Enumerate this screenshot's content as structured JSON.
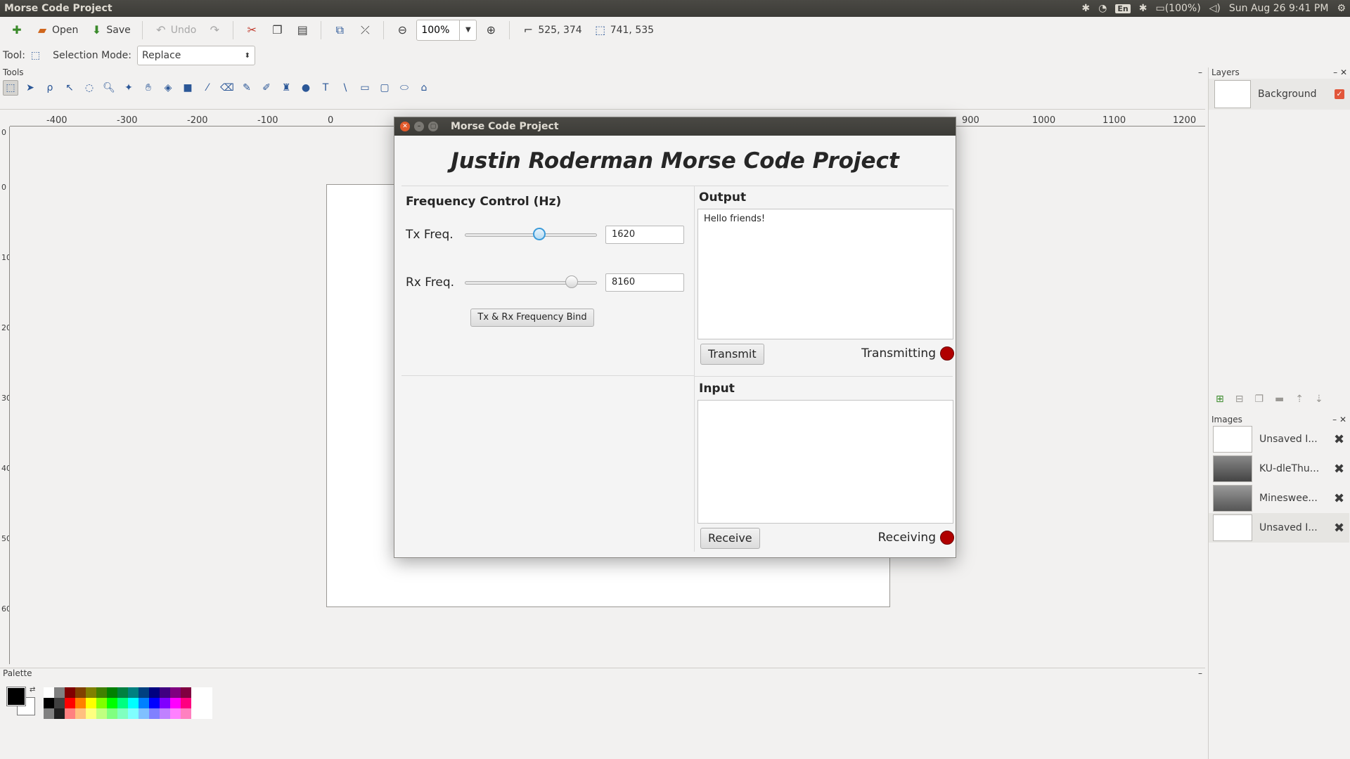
{
  "topbar": {
    "app_title": "Morse Code Project",
    "lang": "En",
    "battery": "(100%)",
    "datetime": "Sun Aug 26  9:41 PM"
  },
  "toolbar": {
    "open": "Open",
    "save": "Save",
    "undo": "Undo",
    "zoom": "100%",
    "cursor_pos": "525, 374",
    "selection_size": "741, 535"
  },
  "tool_options": {
    "tool_label": "Tool:",
    "selection_mode_label": "Selection Mode:",
    "selection_mode": "Replace"
  },
  "panels": {
    "tools": "Tools",
    "layers": "Layers",
    "images": "Images",
    "palette": "Palette"
  },
  "ruler": {
    "h_ticks": [
      "-400",
      "-300",
      "-200",
      "-100",
      "0",
      "900",
      "1000",
      "1100",
      "1200"
    ],
    "v_ticks": [
      "0",
      "0",
      "100",
      "200",
      "300",
      "400",
      "500",
      "600"
    ]
  },
  "layers": [
    {
      "name": "Background"
    }
  ],
  "images": [
    {
      "name": "Unsaved I..."
    },
    {
      "name": "KU-dleThu..."
    },
    {
      "name": "Minesweе..."
    },
    {
      "name": "Unsaved I..."
    }
  ],
  "dialog": {
    "title": "Morse Code Project",
    "heading": "Justin Roderman Morse Code Project",
    "freq_title": "Frequency Control (Hz)",
    "tx_label": "Tx Freq.",
    "tx_value": "1620",
    "tx_slider_fraction": 0.57,
    "rx_label": "Rx Freq.",
    "rx_value": "8160",
    "rx_slider_fraction": 0.84,
    "bind_button": "Tx & Rx Frequency Bind",
    "output_title": "Output",
    "output_text": "Hello friends!",
    "transmit_button": "Transmit",
    "transmitting_label": "Transmitting",
    "input_title": "Input",
    "input_text": "",
    "receive_button": "Receive",
    "receiving_label": "Receiving"
  },
  "colors": {
    "status_led": "#b00000",
    "titlebar": "#3c3b37"
  },
  "palette_colors": [
    "#ffffff",
    "#808080",
    "#800000",
    "#804000",
    "#808000",
    "#408000",
    "#008000",
    "#008040",
    "#008080",
    "#004080",
    "#000080",
    "#400080",
    "#800080",
    "#800040",
    "#ffffff",
    "#ffffff",
    "#000000",
    "#404040",
    "#ff0000",
    "#ff8000",
    "#ffff00",
    "#80ff00",
    "#00ff00",
    "#00ff80",
    "#00ffff",
    "#0080ff",
    "#0000ff",
    "#8000ff",
    "#ff00ff",
    "#ff0080",
    "#ffffff",
    "#ffffff",
    "#808080",
    "#202020",
    "#ff8080",
    "#ffc080",
    "#ffff80",
    "#c0ff80",
    "#80ff80",
    "#80ffc0",
    "#80ffff",
    "#80c0ff",
    "#8080ff",
    "#c080ff",
    "#ff80ff",
    "#ff80c0",
    "#ffffff",
    "#ffffff"
  ]
}
